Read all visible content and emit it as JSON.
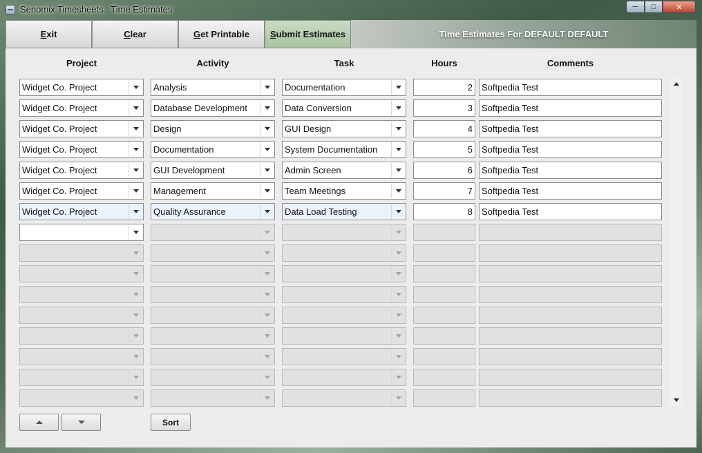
{
  "window": {
    "title": "Senomix Timesheets : Time Estimates",
    "controls": {
      "minimize": "─",
      "maximize": "□",
      "close": "✕"
    }
  },
  "toolbar": {
    "buttons": [
      {
        "mnemonic": "E",
        "rest": "xit"
      },
      {
        "mnemonic": "C",
        "rest": "lear"
      },
      {
        "mnemonic": "G",
        "rest": "et Printable"
      },
      {
        "mnemonic": "S",
        "rest": "ubmit Estimates"
      }
    ],
    "header": "Time Estimates For DEFAULT DEFAULT"
  },
  "columns": {
    "project": "Project",
    "activity": "Activity",
    "task": "Task",
    "hours": "Hours",
    "comments": "Comments"
  },
  "rows": [
    {
      "project": "Widget Co. Project",
      "activity": "Analysis",
      "task": "Documentation",
      "hours": "2",
      "comments": "Softpedia Test"
    },
    {
      "project": "Widget Co. Project",
      "activity": "Database Development",
      "task": "Data Conversion",
      "hours": "3",
      "comments": "Softpedia Test"
    },
    {
      "project": "Widget Co. Project",
      "activity": "Design",
      "task": "GUI Design",
      "hours": "4",
      "comments": "Softpedia Test"
    },
    {
      "project": "Widget Co. Project",
      "activity": "Documentation",
      "task": "System Documentation",
      "hours": "5",
      "comments": "Softpedia Test"
    },
    {
      "project": "Widget Co. Project",
      "activity": "GUI Development",
      "task": "Admin Screen",
      "hours": "6",
      "comments": "Softpedia Test"
    },
    {
      "project": "Widget Co. Project",
      "activity": "Management",
      "task": "Team Meetings",
      "hours": "7",
      "comments": "Softpedia Test"
    },
    {
      "project": "Widget Co. Project",
      "activity": "Quality Assurance",
      "task": "Data Load Testing",
      "hours": "8",
      "comments": "Softpedia Test"
    },
    {
      "project": "",
      "activity": "",
      "task": "",
      "hours": "",
      "comments": ""
    },
    {
      "project": "",
      "activity": "",
      "task": "",
      "hours": "",
      "comments": ""
    },
    {
      "project": "",
      "activity": "",
      "task": "",
      "hours": "",
      "comments": ""
    },
    {
      "project": "",
      "activity": "",
      "task": "",
      "hours": "",
      "comments": ""
    },
    {
      "project": "",
      "activity": "",
      "task": "",
      "hours": "",
      "comments": ""
    },
    {
      "project": "",
      "activity": "",
      "task": "",
      "hours": "",
      "comments": ""
    },
    {
      "project": "",
      "activity": "",
      "task": "",
      "hours": "",
      "comments": ""
    },
    {
      "project": "",
      "activity": "",
      "task": "",
      "hours": "",
      "comments": ""
    },
    {
      "project": "",
      "activity": "",
      "task": "",
      "hours": "",
      "comments": ""
    }
  ],
  "state": {
    "filled_rows": 7,
    "selected_row": 7,
    "enabled_blank_project_row": 8
  },
  "bottom": {
    "sort_label": "Sort",
    "move_up_icon": "triangle-up-icon",
    "move_down_icon": "triangle-down-icon"
  }
}
